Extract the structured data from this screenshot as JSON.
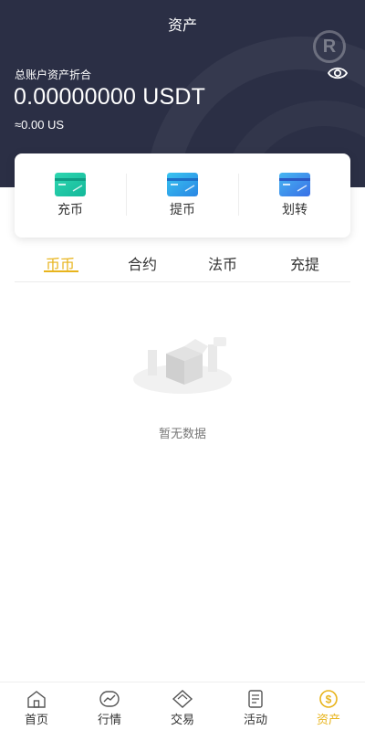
{
  "header": {
    "title": "资产",
    "brand_letter": "R",
    "total_label": "总账户资产折合",
    "total_value": "0.00000000 USDT",
    "approx_value": "≈0.00 US"
  },
  "actions": [
    {
      "label": "充币",
      "icon": "deposit-card-icon",
      "color": "#1fc6a5"
    },
    {
      "label": "提币",
      "icon": "withdraw-card-icon",
      "color": "#2e9de8"
    },
    {
      "label": "划转",
      "icon": "transfer-card-icon",
      "color": "#3a85e8"
    }
  ],
  "tabs": [
    {
      "label": "币币",
      "active": true
    },
    {
      "label": "合约",
      "active": false
    },
    {
      "label": "法币",
      "active": false
    },
    {
      "label": "充提",
      "active": false
    }
  ],
  "empty": {
    "text": "暂无数据"
  },
  "nav": [
    {
      "label": "首页",
      "icon": "home-icon",
      "active": false
    },
    {
      "label": "行情",
      "icon": "market-icon",
      "active": false
    },
    {
      "label": "交易",
      "icon": "trade-icon",
      "active": false
    },
    {
      "label": "活动",
      "icon": "activity-icon",
      "active": false
    },
    {
      "label": "资产",
      "icon": "assets-icon",
      "active": true
    }
  ],
  "colors": {
    "header_bg": "#2b2f45",
    "accent": "#e8b41c"
  }
}
